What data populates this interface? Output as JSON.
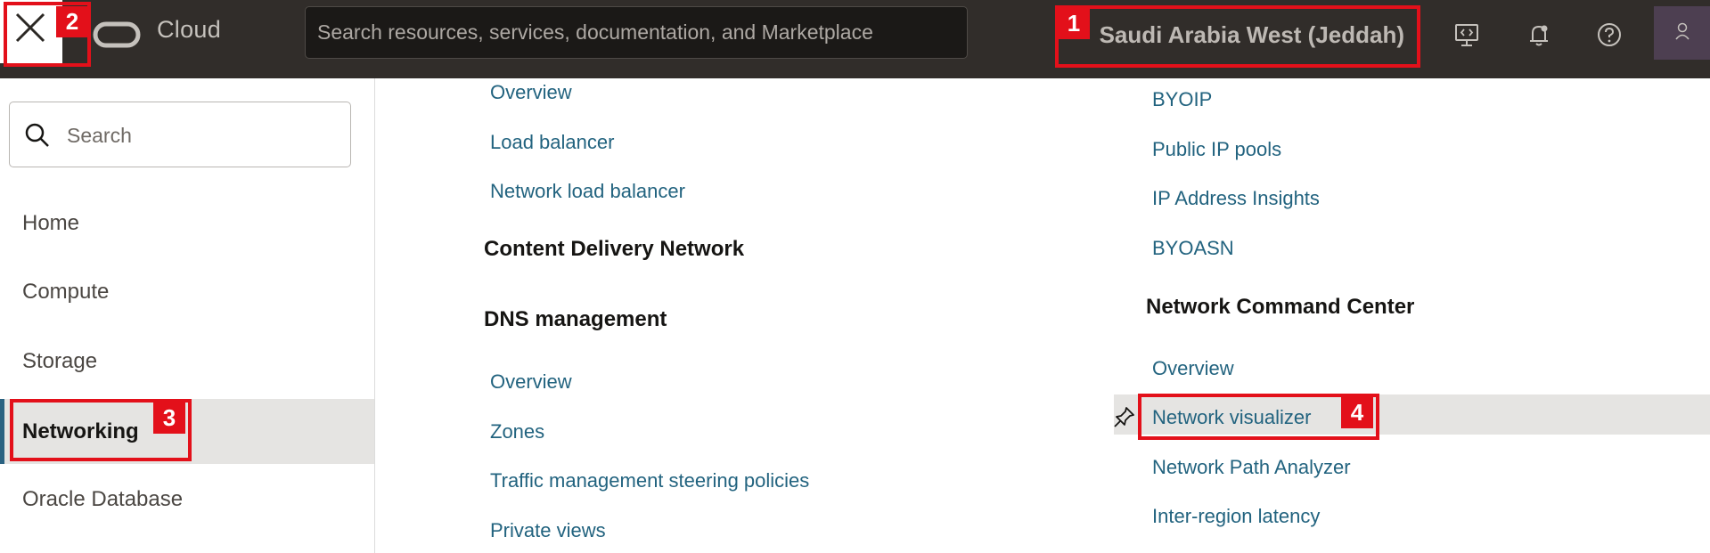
{
  "header": {
    "close_label": "Close navigation menu",
    "brand_text": "Cloud",
    "search_placeholder": "Search resources, services, documentation, and Marketplace",
    "region": "Saudi Arabia West (Jeddah)",
    "icons": [
      "close-icon",
      "oracle-logo-icon",
      "developer-tools-icon",
      "bell-icon",
      "help-icon",
      "user-icon"
    ]
  },
  "sidebar": {
    "search_placeholder": "Search",
    "items": [
      {
        "label": "Home"
      },
      {
        "label": "Compute"
      },
      {
        "label": "Storage"
      },
      {
        "label": "Networking",
        "active": true
      },
      {
        "label": "Oracle Database"
      }
    ]
  },
  "content": {
    "col1": {
      "top_links": [
        "Overview",
        "Load balancer",
        "Network load balancer"
      ],
      "cdn_heading": "Content Delivery Network",
      "dns_heading": "DNS management",
      "dns_links": [
        "Overview",
        "Zones",
        "Traffic management steering policies",
        "Private views"
      ]
    },
    "col2": {
      "top_links": [
        "BYOIP",
        "Public IP pools",
        "IP Address Insights",
        "BYOASN"
      ],
      "ncc_heading": "Network Command Center",
      "ncc_links": [
        "Overview",
        "Network visualizer",
        "Network Path Analyzer",
        "Inter-region latency"
      ]
    }
  },
  "annotations": [
    {
      "number": "1",
      "target": "region selector"
    },
    {
      "number": "2",
      "target": "close menu button"
    },
    {
      "number": "3",
      "target": "Networking"
    },
    {
      "number": "4",
      "target": "Network visualizer"
    }
  ],
  "colors": {
    "topbar": "#312d2a",
    "link": "#22637f",
    "active_indicator": "#2a6281",
    "annotation": "#e3101a",
    "highlight_row": "#e5e4e2"
  }
}
